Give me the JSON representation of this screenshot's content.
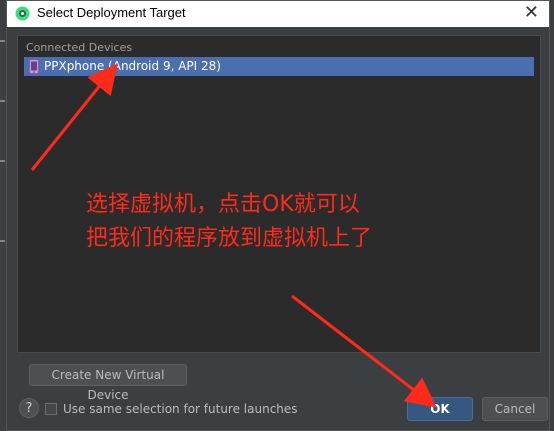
{
  "window": {
    "title": "Select Deployment Target",
    "close_glyph": "✕"
  },
  "devices": {
    "group_label": "Connected Devices",
    "items": [
      {
        "label": "PPXphone (Android 9, API 28)",
        "icon": "phone-icon",
        "selected": true
      }
    ]
  },
  "buttons": {
    "create": "Create New Virtual Device",
    "ok": "OK",
    "cancel": "Cancel",
    "help": "?"
  },
  "options": {
    "remember_label": "Use same selection for future launches",
    "remember_checked": false
  },
  "annotation": {
    "line1": "选择虚拟机，点击OK就可以",
    "line2": "把我们的程序放到虚拟机上了",
    "color": "#ff2a1a"
  },
  "colors": {
    "selection": "#4b6eaf",
    "dialog_bg": "#3c3f41",
    "panel_bg": "#2b2b2b",
    "ok_button": "#365880"
  }
}
